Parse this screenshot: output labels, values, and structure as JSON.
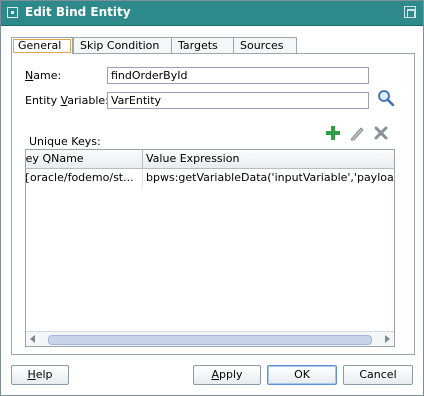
{
  "window": {
    "title": "Edit Bind Entity"
  },
  "tabs": [
    {
      "label": "General",
      "active": true
    },
    {
      "label": "Skip Condition",
      "active": false
    },
    {
      "label": "Targets",
      "active": false
    },
    {
      "label": "Sources",
      "active": false
    }
  ],
  "form": {
    "name_label_mnemonic": "N",
    "name_label_rest": "ame:",
    "name_value": "findOrderById",
    "entity_label_prefix": "Entity ",
    "entity_label_mnemonic": "V",
    "entity_label_rest": "ariable:",
    "entity_value": "VarEntity",
    "search_icon": "magnifier-icon"
  },
  "unique_keys": {
    "label": "Unique Keys:",
    "toolbar": {
      "add_icon": "add-icon",
      "edit_icon": "edit-icon",
      "delete_icon": "delete-icon"
    },
    "columns": [
      "Key QName",
      "Value Expression"
    ],
    "rows": [
      [
        "{oracle/fodemo/st...",
        "bpws:getVariableData('inputVariable','payloa..."
      ]
    ]
  },
  "buttons": {
    "help_mnemonic": "H",
    "help_rest": "elp",
    "apply_mnemonic": "A",
    "apply_rest": "pply",
    "ok": "OK",
    "cancel": "Cancel"
  },
  "colors": {
    "titlebar": "#2e8a8a",
    "active_tab_focus": "#e3a349",
    "add_green": "#2ea043"
  }
}
